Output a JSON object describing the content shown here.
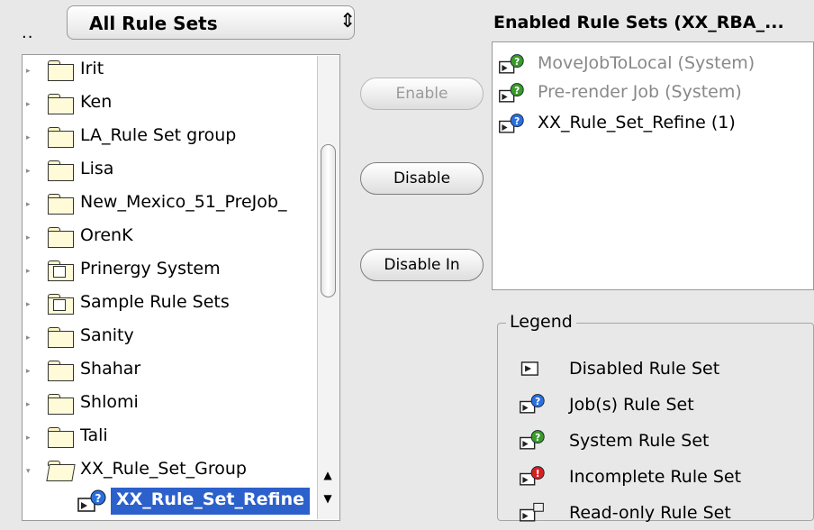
{
  "nav": {
    "up_label": ".."
  },
  "rule_set_filter": {
    "selected": "All Rule Sets"
  },
  "tree": {
    "items": [
      {
        "label": "Irit",
        "type": "folder"
      },
      {
        "label": "Ken",
        "type": "folder"
      },
      {
        "label": "LA_Rule Set group",
        "type": "folder"
      },
      {
        "label": "Lisa",
        "type": "folder"
      },
      {
        "label": "New_Mexico_51_PreJob_",
        "type": "folder"
      },
      {
        "label": "OrenK",
        "type": "folder"
      },
      {
        "label": "Prinergy System",
        "type": "locked-folder"
      },
      {
        "label": "Sample Rule Sets",
        "type": "locked-folder"
      },
      {
        "label": "Sanity",
        "type": "folder"
      },
      {
        "label": "Shahar",
        "type": "folder"
      },
      {
        "label": "Shlomi",
        "type": "folder"
      },
      {
        "label": "Tali",
        "type": "folder"
      },
      {
        "label": "XX_Rule_Set_Group",
        "type": "open-folder"
      }
    ],
    "selected_item": {
      "label": "XX_Rule_Set_Refine",
      "icon": "job-rule-set-icon"
    }
  },
  "actions": {
    "enable": "Enable",
    "disable": "Disable",
    "disable_in": "Disable In"
  },
  "enabled": {
    "title": "Enabled Rule Sets (XX_RBA_...",
    "items": [
      {
        "label": "MoveJobToLocal (System)",
        "icon": "system-rule-set-icon",
        "dimmed": true
      },
      {
        "label": "Pre-render Job (System)",
        "icon": "system-rule-set-icon",
        "dimmed": true
      },
      {
        "label": "XX_Rule_Set_Refine (1)",
        "icon": "job-rule-set-icon",
        "dimmed": false
      }
    ]
  },
  "legend": {
    "title": "Legend",
    "items": [
      {
        "label": "Disabled Rule Set",
        "icon": "disabled-rule-set-icon"
      },
      {
        "label": "Job(s) Rule Set",
        "icon": "job-rule-set-icon"
      },
      {
        "label": "System Rule Set",
        "icon": "system-rule-set-icon"
      },
      {
        "label": "Incomplete Rule Set",
        "icon": "incomplete-rule-set-icon"
      },
      {
        "label": "Read-only Rule Set",
        "icon": "read-only-rule-set-icon"
      }
    ]
  },
  "colors": {
    "selection": "#2c61cc",
    "job_badge": "#2a6fe0",
    "system_badge": "#3a9a2a",
    "incomplete_badge": "#d62020"
  }
}
